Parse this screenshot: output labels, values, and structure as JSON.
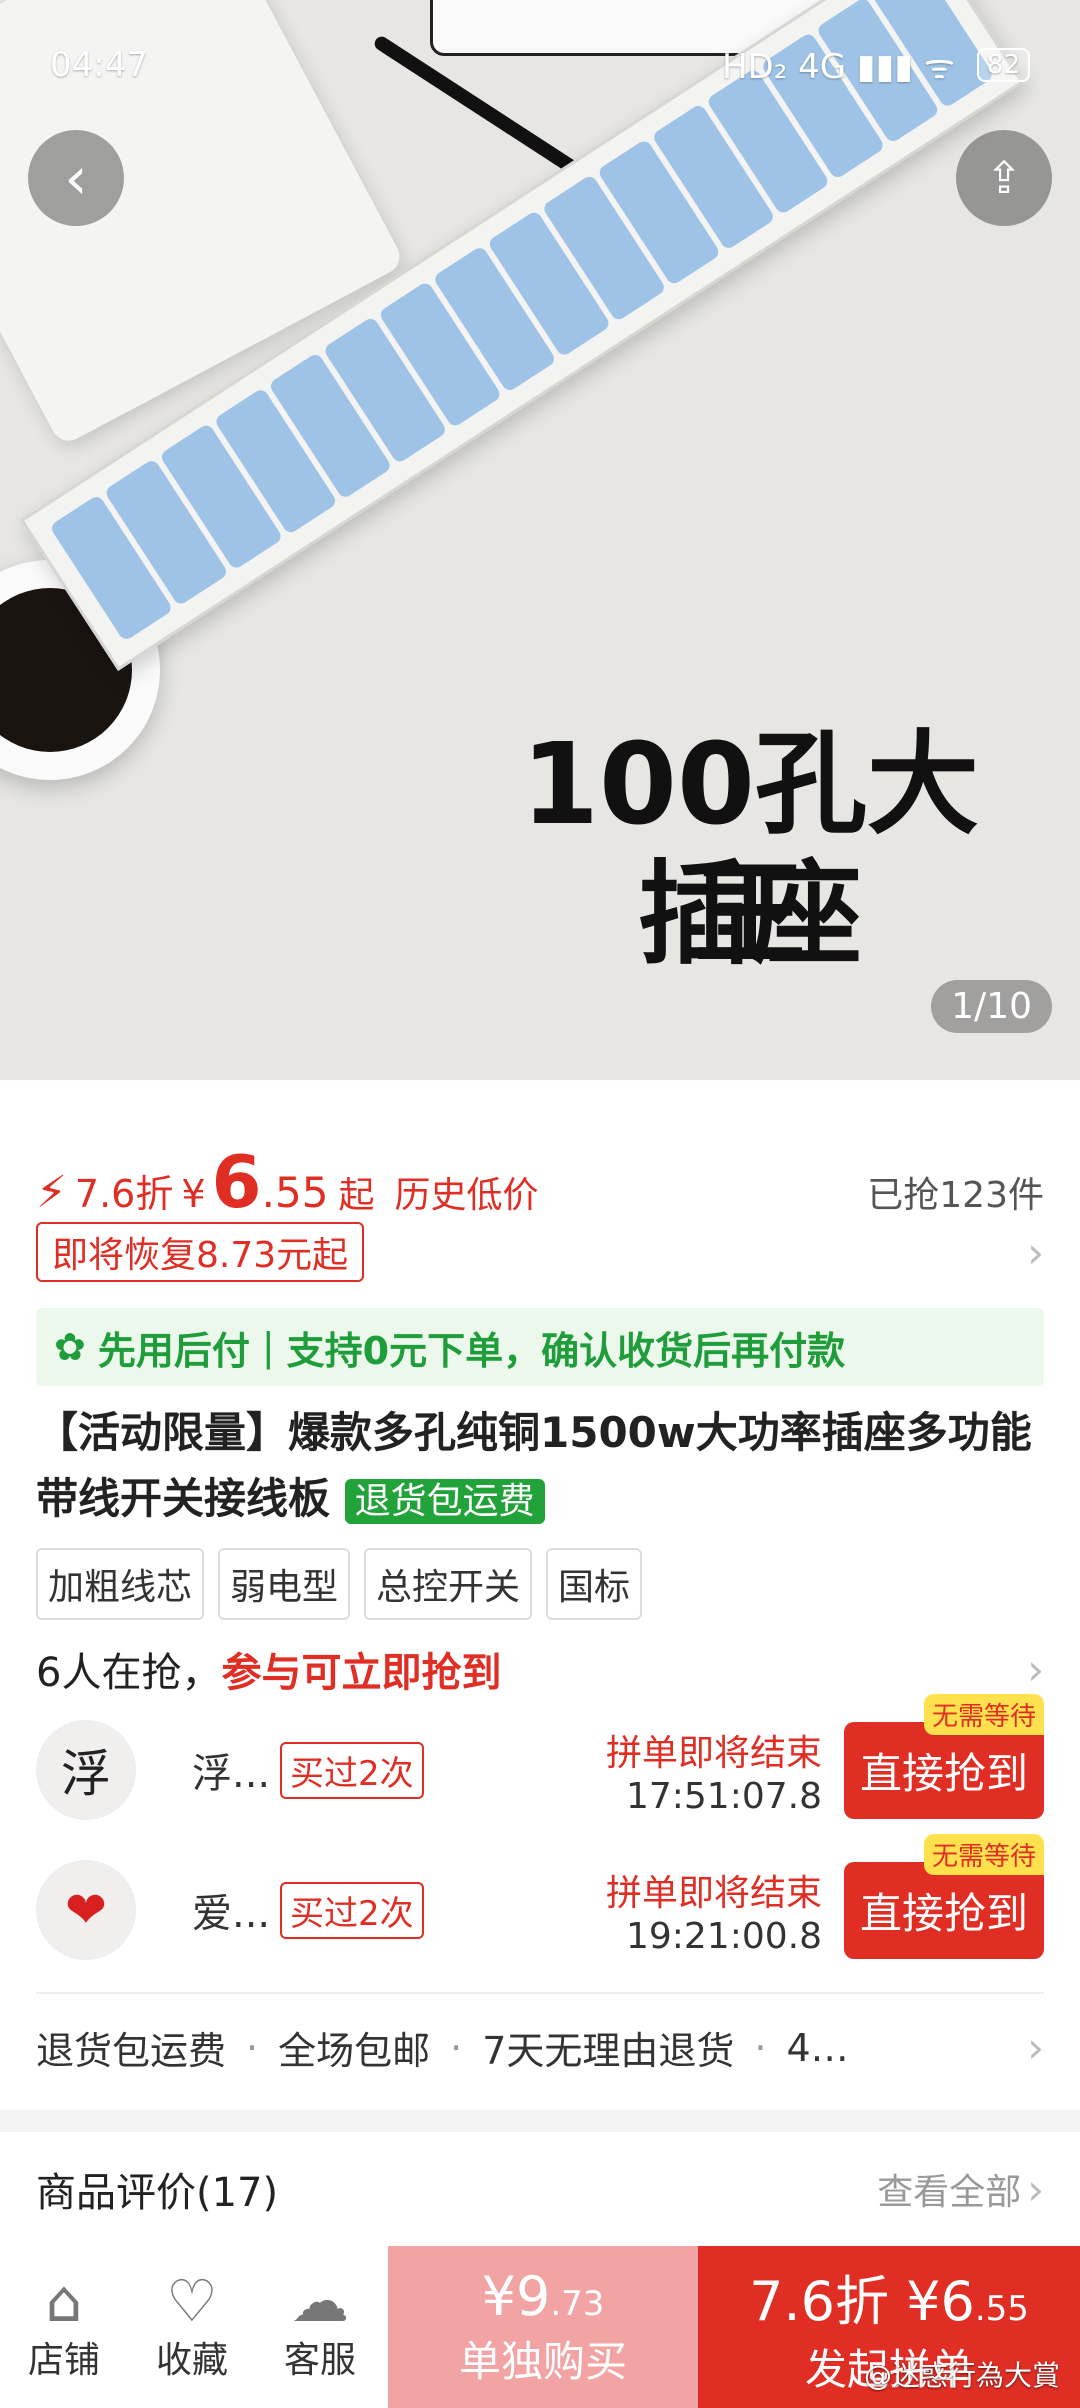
{
  "status_bar": {
    "time": "04:47",
    "right_icons": "HD₂ 4G ▮▮▮ ᯤ",
    "battery": "82"
  },
  "hero": {
    "title_line1": "100孔大王",
    "title_line2": "插座",
    "pager": "1/10",
    "back_icon": "chevron-left-icon",
    "share_icon": "share-icon"
  },
  "price": {
    "bolt": "⚡",
    "discount": "7.6折",
    "currency": "¥",
    "big": "6",
    "cents": ".55",
    "qi": "起",
    "history": "历史低价",
    "sold": "已抢123件",
    "restore": "即将恢复8.73元起"
  },
  "pay_band": {
    "icon": "✿",
    "p1": "先用后付",
    "sep": "|",
    "p2": "支持0元下单，确认收货后再付款"
  },
  "product": {
    "title": "【活动限量】爆款多孔纯铜1500w大功率插座多功能带线开关接线板",
    "badge": "退货包运费"
  },
  "tags": [
    "加粗线芯",
    "弱电型",
    "总控开关",
    "国标"
  ],
  "grab": {
    "count": "6人在抢，",
    "cta": "参与可立即抢到"
  },
  "buyers": [
    {
      "avatar": "浮",
      "name": "浮...",
      "bought": "买过2次",
      "status": "拼单即将结束",
      "time": "17:51:07.8",
      "button": "直接抢到",
      "badge": "无需等待"
    },
    {
      "avatar": "❤",
      "name": "爱...",
      "bought": "买过2次",
      "status": "拼单即将结束",
      "time": "19:21:00.8",
      "button": "直接抢到",
      "badge": "无需等待"
    }
  ],
  "services": [
    "退货包运费",
    "全场包邮",
    "7天无理由退货",
    "4…"
  ],
  "services_sep": "·",
  "reviews": {
    "title": "商品评价(17)",
    "all": "查看全部"
  },
  "bottom": {
    "shop": "店铺",
    "fav": "收藏",
    "service": "客服",
    "solo_price": "¥9",
    "solo_cents": ".73",
    "solo_label": "单独购买",
    "group_price": "7.6折 ¥6",
    "group_cents": ".55",
    "group_label": "发起拼单"
  },
  "watermark": "@迷惑行為大賞",
  "colors": {
    "accent": "#e02e24",
    "green": "#1f9d3a",
    "solo_bg": "#f2a3a3"
  }
}
